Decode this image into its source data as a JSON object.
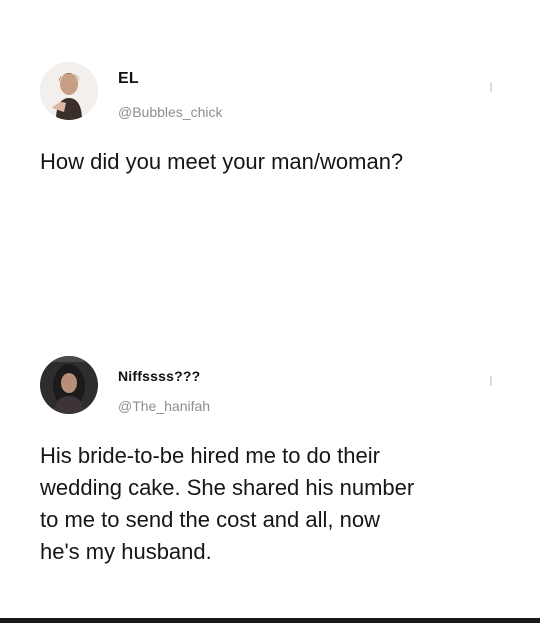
{
  "tweets": [
    {
      "display_name": "EL",
      "handle": "@Bubbles_chick",
      "text": "How did you meet your man/woman?",
      "avatar_icon": "user-avatar-icon",
      "menu_icon": "more-options-icon"
    },
    {
      "display_name": "Niffssss???",
      "handle": "@The_hanifah",
      "text": "His bride-to-be hired me to do their\nwedding cake. She shared his number\nto me to send the cost and all, now\nhe's my husband.",
      "avatar_icon": "user-avatar-icon",
      "menu_icon": "more-options-icon"
    }
  ],
  "colors": {
    "text": "#161616",
    "handle": "#8a8f94",
    "background": "#ffffff"
  }
}
